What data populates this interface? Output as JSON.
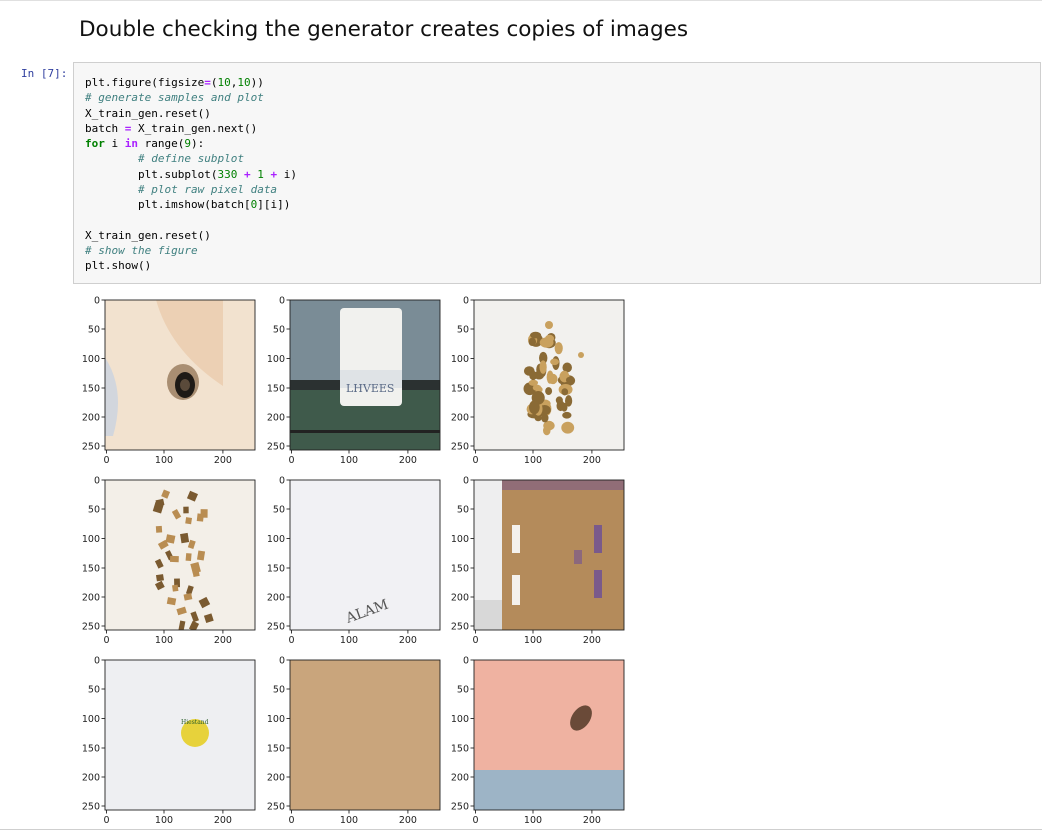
{
  "markdown": {
    "heading": "Double checking the generator creates copies of images"
  },
  "cell": {
    "prompt": "In [7]:",
    "code_lines": [
      [
        {
          "t": "plt.figure(figsize",
          "c": ""
        },
        {
          "t": "=",
          "c": "op"
        },
        {
          "t": "(",
          "c": ""
        },
        {
          "t": "10",
          "c": "num"
        },
        {
          "t": ",",
          "c": ""
        },
        {
          "t": "10",
          "c": "num"
        },
        {
          "t": "))",
          "c": ""
        }
      ],
      [
        {
          "t": "# generate samples and plot",
          "c": "com"
        }
      ],
      [
        {
          "t": "X_train_gen.reset()",
          "c": ""
        }
      ],
      [
        {
          "t": "batch ",
          "c": ""
        },
        {
          "t": "=",
          "c": "op"
        },
        {
          "t": " X_train_gen.next()",
          "c": ""
        }
      ],
      [
        {
          "t": "for",
          "c": "kw"
        },
        {
          "t": " i ",
          "c": ""
        },
        {
          "t": "in",
          "c": "op"
        },
        {
          "t": " range(",
          "c": ""
        },
        {
          "t": "9",
          "c": "num"
        },
        {
          "t": "):",
          "c": ""
        }
      ],
      [
        {
          "t": "        ",
          "c": ""
        },
        {
          "t": "# define subplot",
          "c": "com"
        }
      ],
      [
        {
          "t": "        plt.subplot(",
          "c": ""
        },
        {
          "t": "330",
          "c": "num"
        },
        {
          "t": " + ",
          "c": "op"
        },
        {
          "t": "1",
          "c": "num"
        },
        {
          "t": " + ",
          "c": "op"
        },
        {
          "t": "i)",
          "c": ""
        }
      ],
      [
        {
          "t": "        ",
          "c": ""
        },
        {
          "t": "# plot raw pixel data",
          "c": "com"
        }
      ],
      [
        {
          "t": "        plt.imshow(batch[",
          "c": ""
        },
        {
          "t": "0",
          "c": "num"
        },
        {
          "t": "][i])",
          "c": ""
        }
      ],
      [],
      [
        {
          "t": "X_train_gen.reset()",
          "c": ""
        }
      ],
      [
        {
          "t": "# show the figure",
          "c": "com"
        }
      ],
      [
        {
          "t": "plt.show()",
          "c": ""
        }
      ]
    ]
  },
  "figure": {
    "xticks": [
      "0",
      "100",
      "200"
    ],
    "yticks": [
      "0",
      "50",
      "100",
      "150",
      "200",
      "250"
    ],
    "subplots": [
      {
        "subject": "bottle-neck-on-beige",
        "colors": [
          "#f2e2cf",
          "#d8c3aa",
          "#8a6b4a",
          "#1e1a16"
        ]
      },
      {
        "subject": "pill-bottle-with-label",
        "colors": [
          "#3f5a4b",
          "#f1f1ee",
          "#6e7f74",
          "#2b3131"
        ],
        "label_text": "LHVEES"
      },
      {
        "subject": "scattered-crumbs",
        "colors": [
          "#f2f1ee",
          "#c9a15e",
          "#8a6a35"
        ]
      },
      {
        "subject": "scattered-wood-chips",
        "colors": [
          "#f3efe8",
          "#b98d52",
          "#7a5a30"
        ]
      },
      {
        "subject": "wine-bottle",
        "colors": [
          "#f1f1f4",
          "#2e3b22",
          "#6e6a55",
          "#b9b9b0"
        ],
        "label_text": "ALAM"
      },
      {
        "subject": "cardboard-box",
        "colors": [
          "#eeeeef",
          "#b48b5b",
          "#7a5a8b",
          "#d8d8d8"
        ]
      },
      {
        "subject": "plastic-food-tray",
        "colors": [
          "#eeeff2",
          "#c7ccd1",
          "#e7d23b",
          "#c0392b"
        ],
        "label_text": "Hiestand"
      },
      {
        "subject": "cardboard-flat",
        "colors": [
          "#c9a57c",
          "#b58d62",
          "#8d6b46"
        ]
      },
      {
        "subject": "dark-can-on-pink",
        "colors": [
          "#efb2a1",
          "#9db4c6",
          "#3b2a20",
          "#1a1412"
        ]
      }
    ]
  }
}
